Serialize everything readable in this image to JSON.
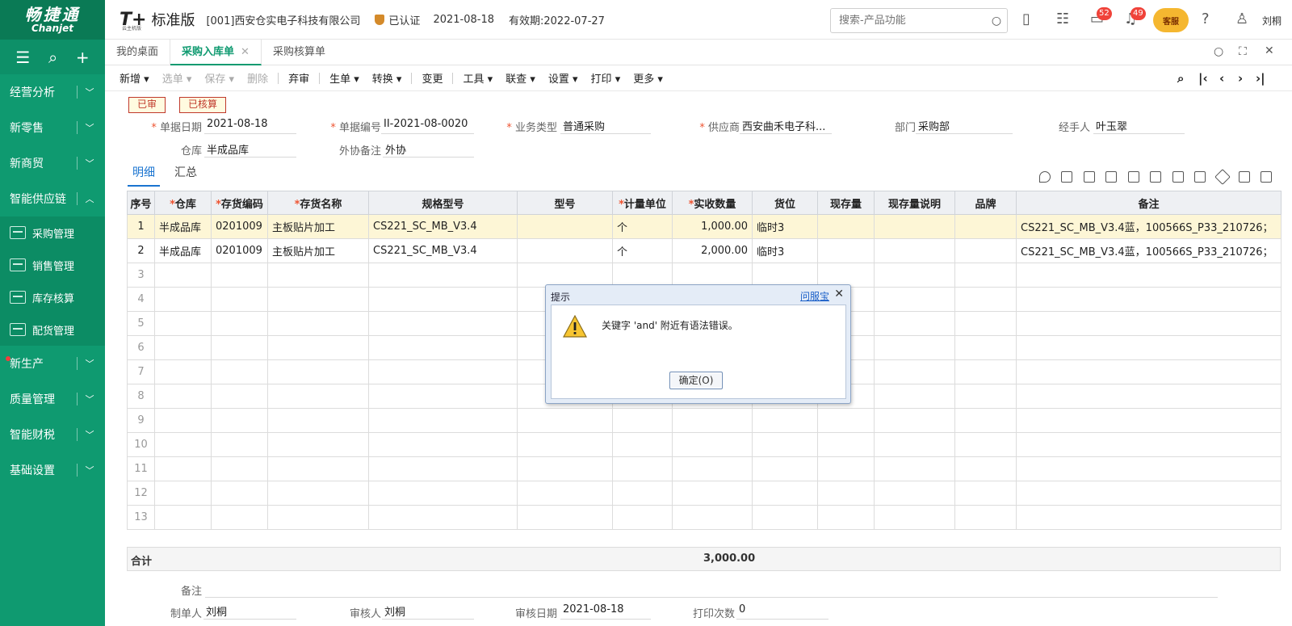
{
  "app": {
    "logo_zh": "畅捷通",
    "logo_en": "Chanjet",
    "product": "T+",
    "product_sub": "云主机版",
    "edition": "标准版",
    "company": "[001]西安仓实电子科技有限公司",
    "certified": "已认证",
    "date": "2021-08-18",
    "validity": "有效期:2022-07-27",
    "search_placeholder": "搜索-产品功能",
    "badge_msg": "52",
    "badge_notify": "49",
    "kefu": "客服",
    "user": "刘桐"
  },
  "sidebar": {
    "items": [
      {
        "label": "经营分析"
      },
      {
        "label": "新零售"
      },
      {
        "label": "新商贸"
      },
      {
        "label": "智能供应链"
      },
      {
        "label": "新生产"
      },
      {
        "label": "质量管理"
      },
      {
        "label": "智能财税"
      },
      {
        "label": "基础设置"
      }
    ],
    "subitems": [
      {
        "label": "采购管理"
      },
      {
        "label": "销售管理"
      },
      {
        "label": "库存核算"
      },
      {
        "label": "配货管理"
      }
    ]
  },
  "tabs": [
    {
      "label": "我的桌面"
    },
    {
      "label": "采购入库单"
    },
    {
      "label": "采购核算单"
    }
  ],
  "toolbar": {
    "xinzeng": "新增",
    "xuandan": "选单",
    "baocun": "保存",
    "shanchu": "删除",
    "qishen": "弃审",
    "shengdan": "生单",
    "zhuanhuan": "转换",
    "biangeng": "变更",
    "gongju": "工具",
    "lianchai": "联查",
    "shezhi": "设置",
    "dayin": "打印",
    "gengduo": "更多"
  },
  "status": {
    "audited": "已审",
    "accounted": "已核算"
  },
  "form": {
    "date_label": "单据日期",
    "date_value": "2021-08-18",
    "code_label": "单据编号",
    "code_value": "II-2021-08-0020",
    "biztype_label": "业务类型",
    "biztype_value": "普通采购",
    "supplier_label": "供应商",
    "supplier_value": "西安曲禾电子科...",
    "dept_label": "部门",
    "dept_value": "采购部",
    "handler_label": "经手人",
    "handler_value": "叶玉翠",
    "warehouse_label": "仓库",
    "warehouse_value": "半成品库",
    "outsource_label": "外协备注",
    "outsource_value": "外协"
  },
  "subtabs": {
    "detail": "明细",
    "summary": "汇总"
  },
  "grid": {
    "headers": [
      "序号",
      "仓库",
      "存货编码",
      "存货名称",
      "规格型号",
      "型号",
      "计量单位",
      "实收数量",
      "货位",
      "现存量",
      "现存量说明",
      "品牌",
      "备注"
    ],
    "rows": [
      {
        "seq": "1",
        "warehouse": "半成品库",
        "code": "0201009",
        "name": "主板贴片加工",
        "spec": "CS221_SC_MB_V3.4",
        "model": "",
        "unit": "个",
        "qty": "1,000.00",
        "location": "临时3",
        "stock": "",
        "stock_note": "",
        "brand": "",
        "remark": "CS221_SC_MB_V3.4蓝，100566S_P33_210726；"
      },
      {
        "seq": "2",
        "warehouse": "半成品库",
        "code": "0201009",
        "name": "主板贴片加工",
        "spec": "CS221_SC_MB_V3.4",
        "model": "",
        "unit": "个",
        "qty": "2,000.00",
        "location": "临时3",
        "stock": "",
        "stock_note": "",
        "brand": "",
        "remark": "CS221_SC_MB_V3.4蓝，100566S_P33_210726；"
      }
    ],
    "empty_seq": [
      "3",
      "4",
      "5",
      "6",
      "7",
      "8",
      "9",
      "10",
      "11",
      "12",
      "13"
    ]
  },
  "total": {
    "label": "合计",
    "qty": "3,000.00"
  },
  "footer": {
    "remark_label": "备注",
    "maker_label": "制单人",
    "maker_value": "刘桐",
    "auditor_label": "审核人",
    "auditor_value": "刘桐",
    "audit_date_label": "审核日期",
    "audit_date_value": "2021-08-18",
    "print_label": "打印次数",
    "print_value": "0"
  },
  "dialog": {
    "title": "提示",
    "help_link": "问服宝",
    "message": "关键字 'and' 附近有语法错误。",
    "ok_label": "确定(O)"
  },
  "colors": {
    "brand": "#0f9a70",
    "accent_blue": "#1a74d0",
    "stamp_red": "#c0392b"
  }
}
